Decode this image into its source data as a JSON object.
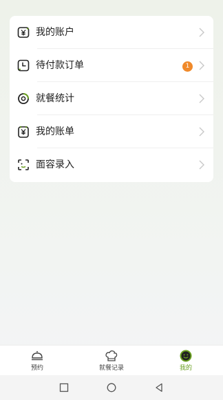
{
  "menu": [
    {
      "label": "我的账户",
      "icon": "yen-wallet-icon"
    },
    {
      "label": "待付款订单",
      "icon": "clock-icon",
      "badge": "1"
    },
    {
      "label": "就餐统计",
      "icon": "donut-chart-icon"
    },
    {
      "label": "我的账单",
      "icon": "yen-bill-icon"
    },
    {
      "label": "面容录入",
      "icon": "face-scan-icon"
    }
  ],
  "tabs": [
    {
      "label": "预约",
      "icon": "cloche-icon"
    },
    {
      "label": "就餐记录",
      "icon": "chef-hat-icon"
    },
    {
      "label": "我的",
      "icon": "smiley-icon",
      "active": true
    }
  ],
  "colors": {
    "accent": "#6aa021",
    "badge": "#f08a2b"
  }
}
